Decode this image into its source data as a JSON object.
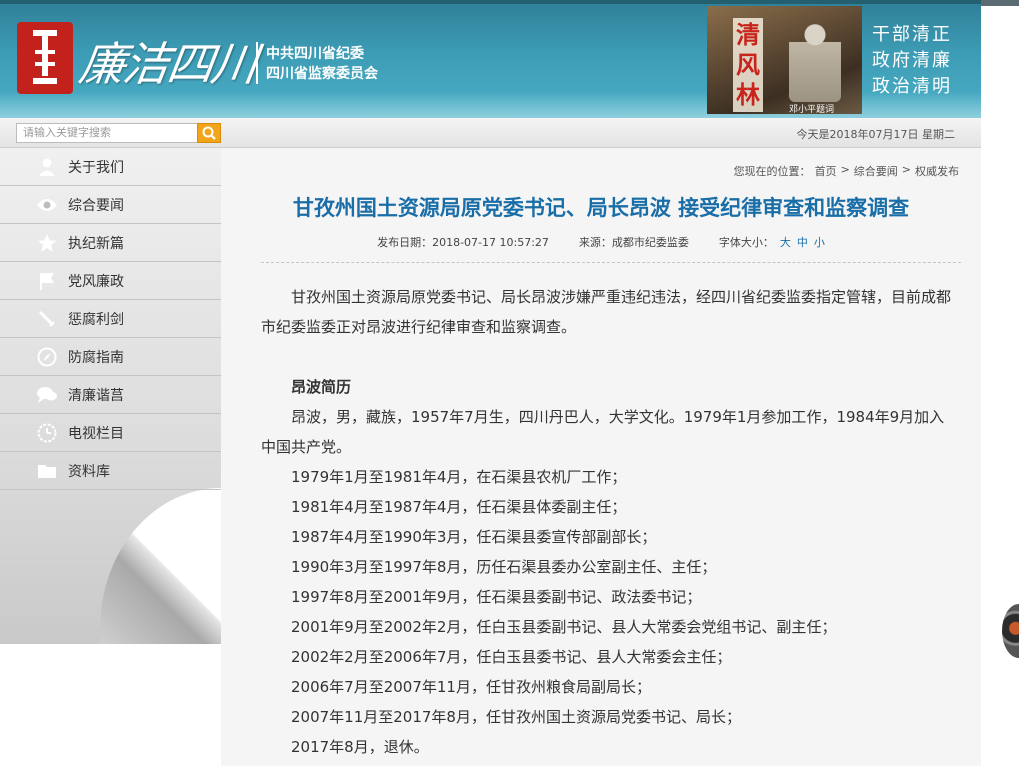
{
  "banner": {
    "calligraphy": "廉洁四川",
    "org_line1": "中共四川省纪委",
    "org_line2": "四川省监察委员会",
    "photo_title": "清风林",
    "photo_caption": "邓小平题词",
    "slogan": [
      "干部清正",
      "政府清廉",
      "政治清明"
    ]
  },
  "search": {
    "placeholder": "请输入关键字搜索",
    "date_text": "今天是2018年07月17日 星期二"
  },
  "sidebar": {
    "items": [
      {
        "label": "关于我们",
        "icon": "user-icon"
      },
      {
        "label": "综合要闻",
        "icon": "eye-icon"
      },
      {
        "label": "执纪新篇",
        "icon": "star-icon"
      },
      {
        "label": "党风廉政",
        "icon": "flag-icon"
      },
      {
        "label": "惩腐利剑",
        "icon": "sword-icon"
      },
      {
        "label": "防腐指南",
        "icon": "compass-icon"
      },
      {
        "label": "清廉谐莒",
        "icon": "chat-icon"
      },
      {
        "label": "电视栏目",
        "icon": "clock-icon"
      },
      {
        "label": "资料库",
        "icon": "folder-icon"
      }
    ]
  },
  "breadcrumb": {
    "prefix": "您现在的位置：",
    "items": [
      "首页",
      "综合要闻",
      "权威发布"
    ],
    "sep": ">"
  },
  "article": {
    "title": "甘孜州国土资源局原党委书记、局长昂波 接受纪律审查和监察调查",
    "publish_date": "发布日期：2018-07-17 10:57:27",
    "source": "来源：成都市纪委监委",
    "font_size_label": "字体大小：",
    "size_options": [
      "大",
      "中",
      "小"
    ],
    "intro": "甘孜州国土资源局原党委书记、局长昂波涉嫌严重违纪违法，经四川省纪委监委指定管辖，目前成都市纪委监委正对昂波进行纪律审查和监察调查。",
    "bio_heading": "昂波简历",
    "bio_intro": "昂波，男，藏族，1957年7月生，四川丹巴人，大学文化。1979年1月参加工作，1984年9月加入中国共产党。",
    "career": [
      "1979年1月至1981年4月，在石渠县农机厂工作；",
      "1981年4月至1987年4月，任石渠县体委副主任；",
      "1987年4月至1990年3月，任石渠县委宣传部副部长；",
      "1990年3月至1997年8月，历任石渠县委办公室副主任、主任；",
      "1997年8月至2001年9月，任石渠县委副书记、政法委书记；",
      "2001年9月至2002年2月，任白玉县委副书记、县人大常委会党组书记、副主任；",
      "2002年2月至2006年7月，任白玉县委书记、县人大常委会主任；",
      "2006年7月至2007年11月，任甘孜州粮食局副局长；",
      "2007年11月至2017年8月，任甘孜州国土资源局党委书记、局长；",
      "2017年8月，退休。"
    ]
  },
  "colors": {
    "banner": "#3d9cb5",
    "title": "#1a6ea8",
    "seal": "#c3221c",
    "search_button": "#f2a51a"
  }
}
